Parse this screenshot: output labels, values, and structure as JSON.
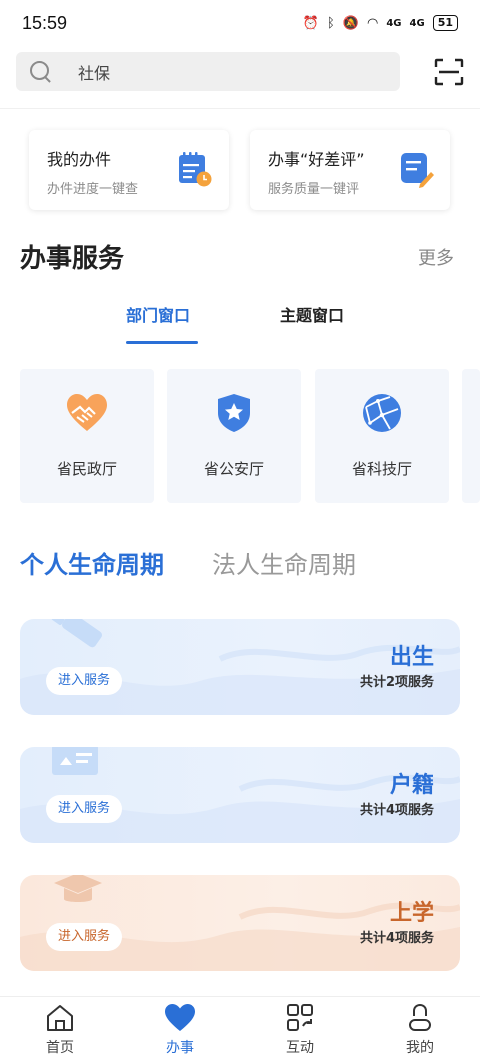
{
  "status_bar": {
    "time": "15:59",
    "signal_1": "4G",
    "signal_2": "4G",
    "battery": "51"
  },
  "search": {
    "placeholder": "社保"
  },
  "quick_cards": [
    {
      "title": "我的办件",
      "subtitle": "办件进度一键查",
      "icon": "calendar-clock-icon"
    },
    {
      "title": "办事“好差评”",
      "subtitle": "服务质量一键评",
      "icon": "document-edit-icon"
    }
  ],
  "services_section": {
    "title": "办事服务",
    "more": "更多",
    "tabs": [
      "部门窗口",
      "主题窗口"
    ],
    "active_tab": 0,
    "departments": [
      {
        "label": "省民政厅",
        "icon": "heart-hands-icon"
      },
      {
        "label": "省公安厅",
        "icon": "police-shield-icon"
      },
      {
        "label": "省科技厅",
        "icon": "globe-network-icon"
      }
    ]
  },
  "lifecycle": {
    "tabs": [
      "个人生命周期",
      "法人生命周期"
    ],
    "active_tab": 0,
    "cards": [
      {
        "title": "出生",
        "count": "共计2项服务",
        "button": "进入服务",
        "icon": "baby-bottle-icon",
        "theme": "blue"
      },
      {
        "title": "户籍",
        "count": "共计4项服务",
        "button": "进入服务",
        "icon": "id-card-icon",
        "theme": "blue"
      },
      {
        "title": "上学",
        "count": "共计4项服务",
        "button": "进入服务",
        "icon": "graduation-cap-icon",
        "theme": "orange"
      }
    ]
  },
  "bottom_nav": [
    {
      "label": "首页",
      "icon": "home-icon"
    },
    {
      "label": "办事",
      "icon": "heart-icon"
    },
    {
      "label": "互动",
      "icon": "interact-icon"
    },
    {
      "label": "我的",
      "icon": "user-icon"
    }
  ],
  "active_nav": 1,
  "colors": {
    "accent": "#2a6fd6",
    "orange_accent": "#c8662c"
  }
}
